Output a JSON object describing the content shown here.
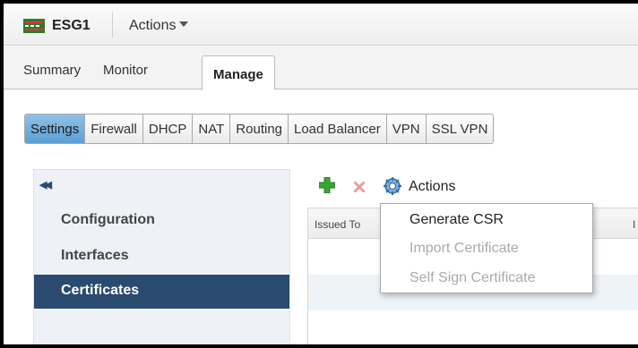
{
  "header": {
    "object_name": "ESG1",
    "actions_label": "Actions",
    "icon": "edge-gateway-icon"
  },
  "main_tabs": [
    {
      "label": "Summary",
      "active": false
    },
    {
      "label": "Monitor",
      "active": false
    },
    {
      "label": "Manage",
      "active": true
    }
  ],
  "sub_tabs": [
    {
      "label": "Settings",
      "active": true
    },
    {
      "label": "Firewall",
      "active": false
    },
    {
      "label": "DHCP",
      "active": false
    },
    {
      "label": "NAT",
      "active": false
    },
    {
      "label": "Routing",
      "active": false
    },
    {
      "label": "Load Balancer",
      "active": false
    },
    {
      "label": "VPN",
      "active": false
    },
    {
      "label": "SSL VPN",
      "active": false
    }
  ],
  "left_nav": {
    "collapse_icon": "double-chevron-left-icon",
    "items": [
      {
        "label": "Configuration",
        "active": false
      },
      {
        "label": "Interfaces",
        "active": false
      },
      {
        "label": "Certificates",
        "active": true
      }
    ]
  },
  "toolbar": {
    "add_icon": "plus-icon",
    "delete_icon": "delete-x-icon",
    "actions_icon": "gear-icon",
    "actions_label": "Actions"
  },
  "grid": {
    "columns": [
      "Issued To",
      "I"
    ]
  },
  "actions_menu": {
    "items": [
      {
        "label": "Generate CSR",
        "enabled": true
      },
      {
        "label": "Import Certificate",
        "enabled": false
      },
      {
        "label": "Self Sign Certificate",
        "enabled": false
      }
    ]
  },
  "colors": {
    "active_subtab": "#6aa9da",
    "active_nav": "#2b4a6f",
    "add_green": "#3aa335",
    "delete_red": "#e07b7b",
    "gear_blue": "#4a86c5"
  }
}
